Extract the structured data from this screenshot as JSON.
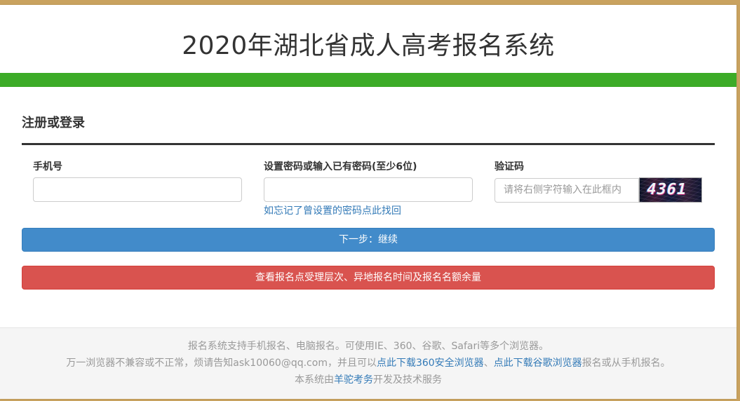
{
  "header": {
    "title": "2020年湖北省成人高考报名系统"
  },
  "colors": {
    "green_bar": "#3cab27",
    "primary_button": "#428bca",
    "danger_button": "#d9534f",
    "link": "#337ab7"
  },
  "form": {
    "section_title": "注册或登录",
    "phone": {
      "label": "手机号",
      "value": "",
      "placeholder": ""
    },
    "password": {
      "label": "设置密码或输入已有密码(至少6位)",
      "value": "",
      "placeholder": "",
      "forgot_link": "如忘记了曾设置的密码点此找回"
    },
    "captcha": {
      "label": "验证码",
      "value": "",
      "placeholder": "请将右侧字符输入在此框内",
      "image_code": "4361"
    },
    "next_button": "下一步：继续",
    "check_button": "查看报名点受理层次、异地报名时间及报名名额余量"
  },
  "footer": {
    "line1": "报名系统支持手机报名、电脑报名。可使用IE、360、谷歌、Safari等多个浏览器。",
    "line2_prefix": "万一浏览器不兼容或不正常，烦请告知ask10060@qq.com，并且可以",
    "line2_link1": "点此下载360安全浏览器",
    "line2_sep": "、",
    "line2_link2": "点此下载谷歌浏览器",
    "line2_suffix": "报名或从手机报名。",
    "line3_prefix": "本系统由",
    "line3_link": "羊驼考务",
    "line3_suffix": "开发及技术服务"
  }
}
